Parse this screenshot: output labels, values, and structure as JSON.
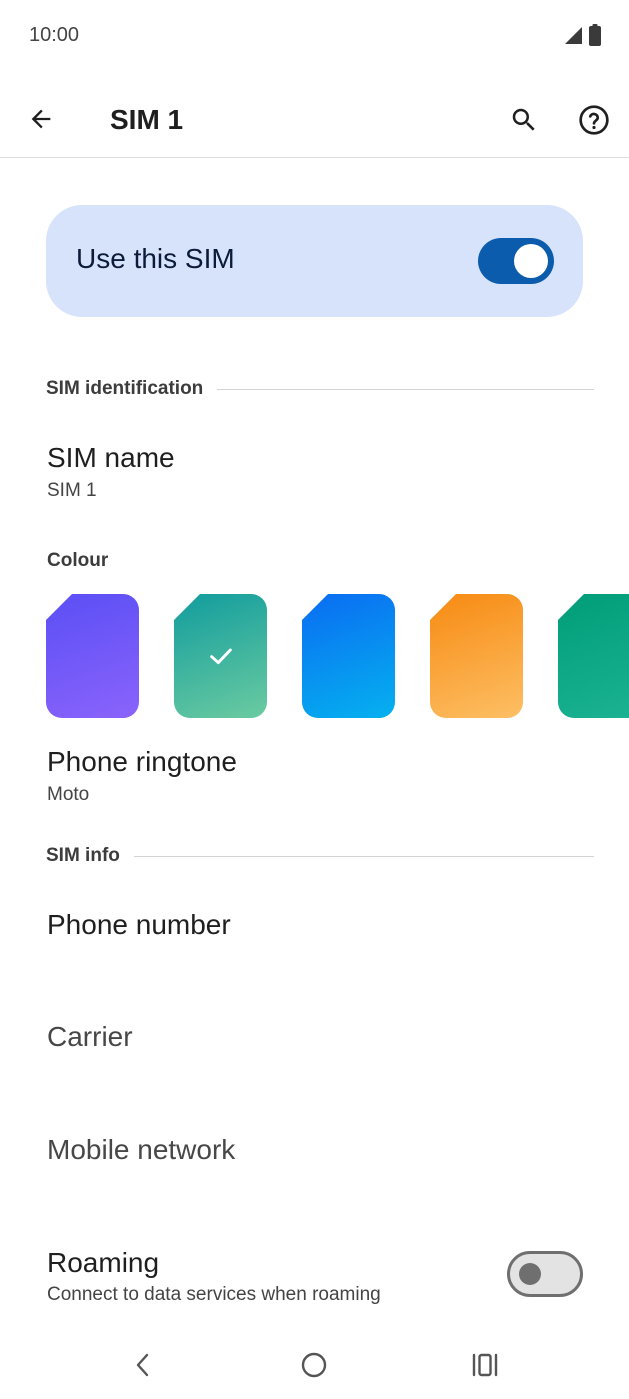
{
  "status_bar": {
    "time": "10:00",
    "icons": [
      "signal-icon",
      "battery-icon"
    ]
  },
  "app_bar": {
    "title": "SIM 1",
    "icons": [
      "back-arrow-icon",
      "search-icon",
      "help-icon"
    ]
  },
  "main_switch": {
    "label": "Use this SIM",
    "checked": true
  },
  "sim_identification": {
    "header": "SIM identification",
    "sim_name_title": "SIM name",
    "sim_name_value": "SIM 1",
    "colour_label": "Colour",
    "colours": [
      {
        "name": "purple",
        "from": "#5a4ff5",
        "to": "#8b63fb",
        "selected": false
      },
      {
        "name": "teal",
        "from": "#119c9e",
        "to": "#6bcba0",
        "selected": true
      },
      {
        "name": "blue",
        "from": "#0a6cf2",
        "to": "#05b1ef",
        "selected": false
      },
      {
        "name": "orange",
        "from": "#f78a12",
        "to": "#fdbf64",
        "selected": false
      },
      {
        "name": "green",
        "from": "#009d78",
        "to": "#1cb393",
        "selected": false
      }
    ],
    "ringtone_title": "Phone ringtone",
    "ringtone_value": "Moto"
  },
  "sim_info": {
    "header": "SIM info",
    "phone_number_title": "Phone number",
    "carrier_title": "Carrier",
    "mobile_network_title": "Mobile network",
    "roaming_title": "Roaming",
    "roaming_summary": "Connect to data services when roaming",
    "roaming_checked": false
  },
  "nav_bar": {
    "icons": [
      "nav-back-icon",
      "nav-home-icon",
      "nav-recents-icon"
    ]
  },
  "colors": {
    "accent": "#0b5cad",
    "switch_card": "#d7e3fb"
  }
}
